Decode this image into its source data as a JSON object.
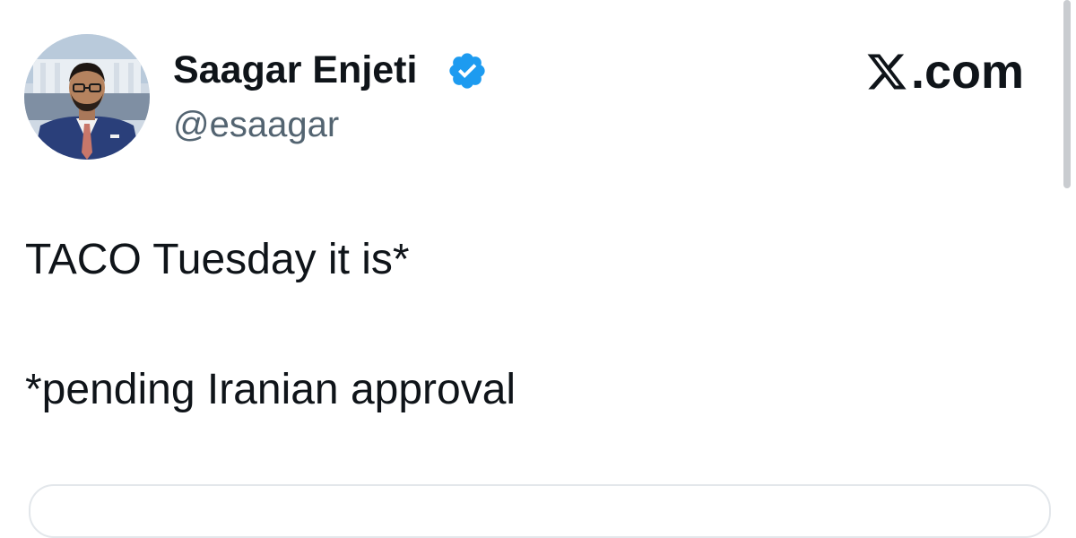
{
  "author": {
    "display_name": "Saagar Enjeti",
    "handle": "@esaagar",
    "verified": true,
    "avatar_icon": "profile-photo"
  },
  "brand": {
    "suffix": ".com",
    "icon": "x-logo-icon"
  },
  "tweet": {
    "line1": "TACO Tuesday it is*",
    "line2": "*pending Iranian approval"
  },
  "colors": {
    "text": "#0f1419",
    "handle": "#536471",
    "verified_blue": "#1d9bf0"
  }
}
